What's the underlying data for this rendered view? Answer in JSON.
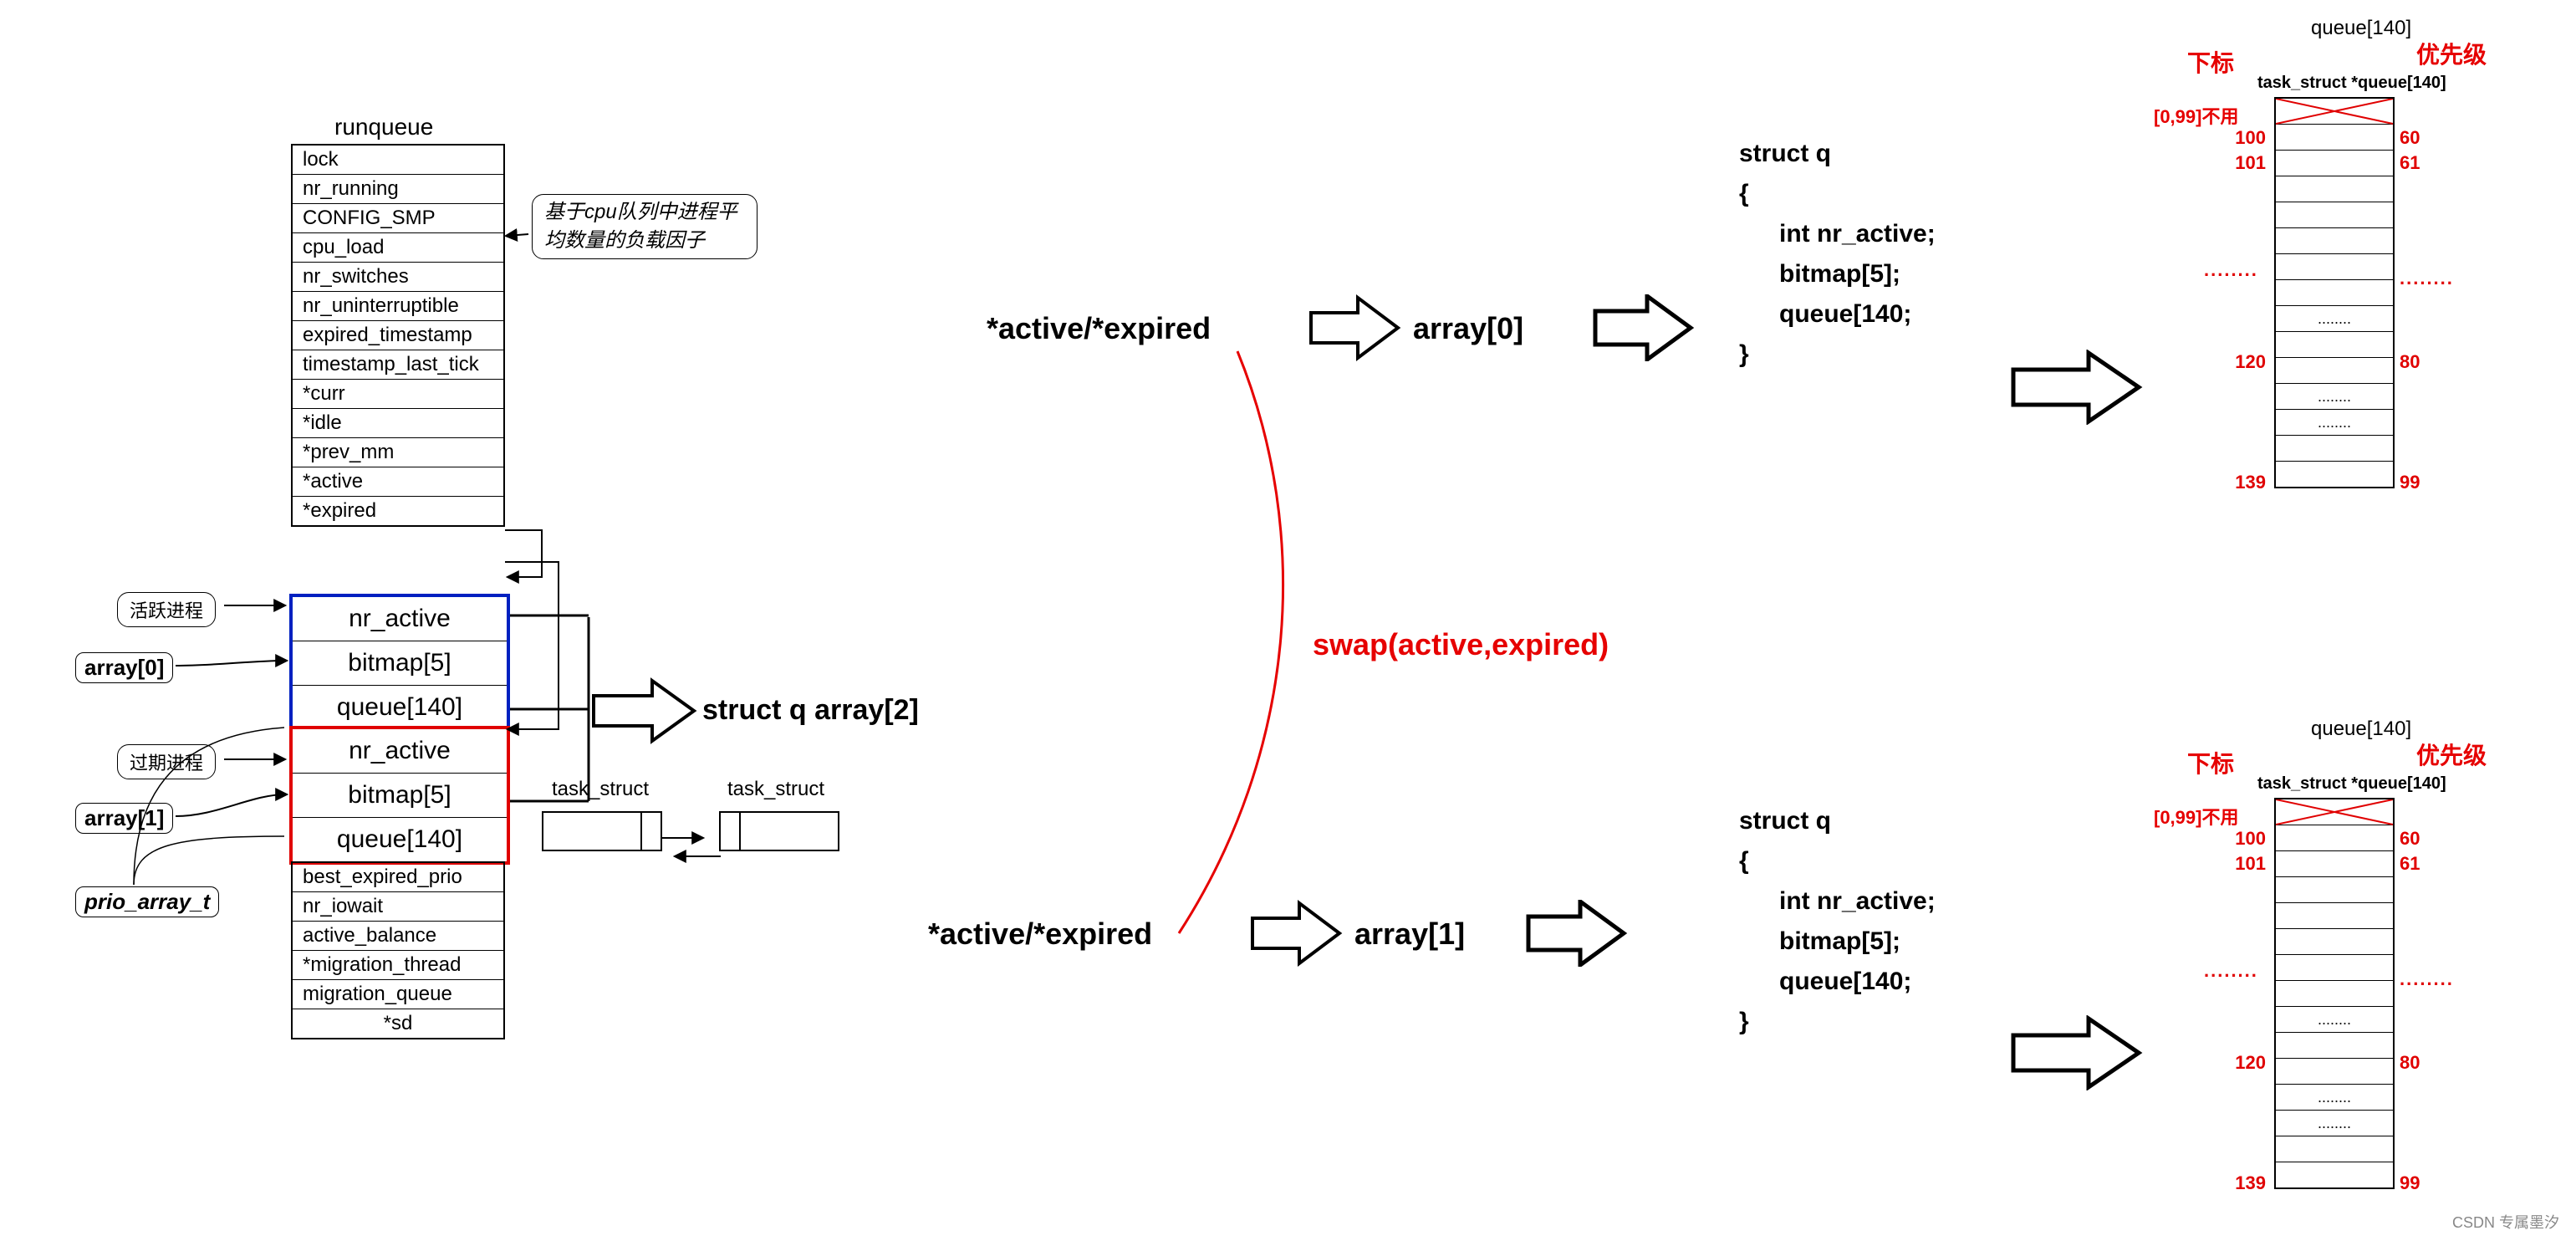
{
  "runqueue": {
    "title": "runqueue",
    "rows": [
      "lock",
      "nr_running",
      "CONFIG_SMP",
      "cpu_load",
      "nr_switches",
      "nr_uninterruptible",
      "expired_timestamp",
      "timestamp_last_tick",
      "*curr",
      "*idle",
      "*prev_mm",
      "*active",
      "*expired"
    ],
    "group_a": [
      "nr_active",
      "bitmap[5]",
      "queue[140]"
    ],
    "group_b": [
      "nr_active",
      "bitmap[5]",
      "queue[140]"
    ],
    "rows_tail": [
      "best_expired_prio",
      "nr_iowait",
      "active_balance",
      "*migration_thread",
      "migration_queue",
      "*sd"
    ],
    "note_cpu": "基于cpu队列中进程平均数量的负载因子",
    "note_active": "活跃进程",
    "note_expired": "过期进程",
    "tag_arr0": "array[0]",
    "tag_arr1": "array[1]",
    "tag_prio": "prio_array_t",
    "struct_label": "struct q array[2]",
    "ts_label": "task_struct"
  },
  "flow": {
    "ptr_label": "*active/*expired",
    "arr0": "array[0]",
    "arr1": "array[1]",
    "swap": "swap(active,expired)"
  },
  "structq": {
    "l1": "struct q",
    "l2": "{",
    "l3": "int nr_active;",
    "l4": "bitmap[5];",
    "l5": "queue[140;",
    "l6": "}"
  },
  "queue_panel": {
    "title": "queue[140]",
    "idx_label": "下标",
    "pri_label": "优先级",
    "caption": "task_struct *queue[140]",
    "unused": "[0,99]不用",
    "idx": [
      "100",
      "101",
      "120",
      "139"
    ],
    "pri": [
      "60",
      "61",
      "80",
      "99"
    ],
    "dots": "........"
  },
  "watermark": "CSDN 专属墨汐"
}
